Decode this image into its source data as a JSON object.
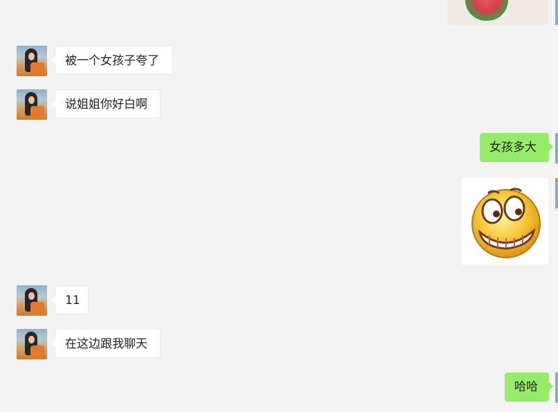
{
  "messages": [
    {
      "side": "left",
      "type": "text",
      "text": "被一个女孩子夸了"
    },
    {
      "side": "left",
      "type": "text",
      "text": "说姐姐你好白啊"
    },
    {
      "side": "right",
      "type": "text",
      "text": "女孩多大"
    },
    {
      "side": "right",
      "type": "sticker",
      "sticker": "grinning-emoji"
    },
    {
      "side": "left",
      "type": "text",
      "text": "11"
    },
    {
      "side": "left",
      "type": "text",
      "text": "在这边跟我聊天"
    },
    {
      "side": "right",
      "type": "text",
      "text": "哈哈"
    }
  ],
  "top_sticker": "watermelon-sticker",
  "colors": {
    "background": "#f4f4f4",
    "incoming_bubble": "#ffffff",
    "outgoing_bubble": "#95ec69",
    "text": "#222222"
  }
}
